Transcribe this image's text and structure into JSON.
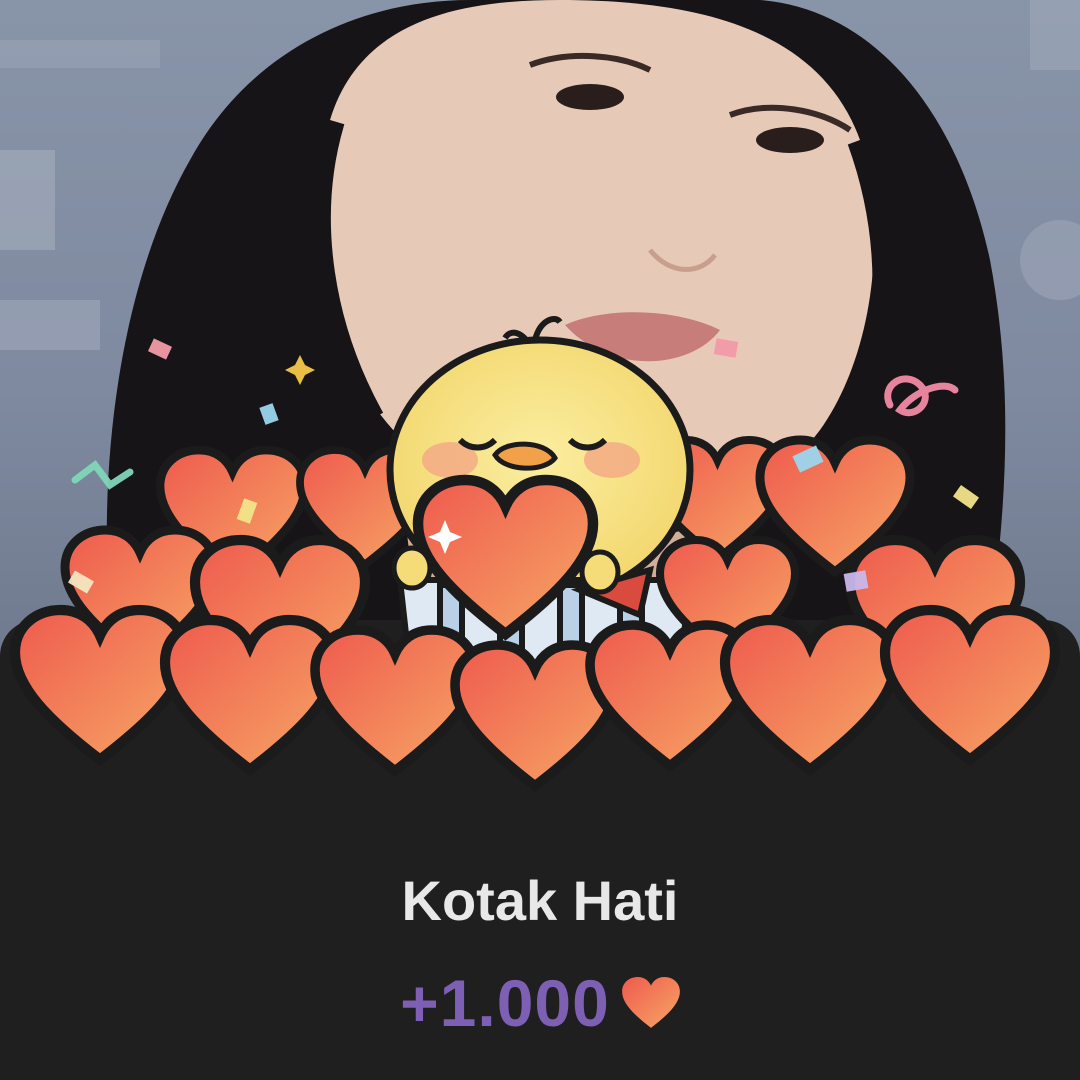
{
  "gift": {
    "title": "Kotak Hati",
    "amount": "+1.000",
    "currency_icon": "heart-icon"
  },
  "colors": {
    "background": "#1f1f1f",
    "title": "#e8e8e8",
    "amount": "#7d5fb3",
    "heart_light": "#f59a5e",
    "heart_dark": "#ee5a4e",
    "chick": "#f7e07a"
  }
}
